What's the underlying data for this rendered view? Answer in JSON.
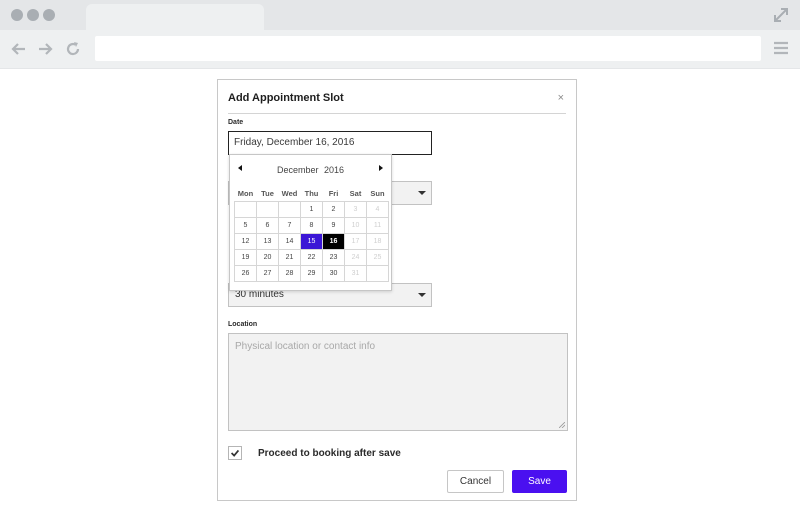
{
  "dialog": {
    "title": "Add Appointment Slot",
    "close": "×",
    "date_label": "Date",
    "date_value": "Friday, December 16, 2016",
    "duration_value": "30 minutes",
    "location_label": "Location",
    "location_placeholder": "Physical location or contact info",
    "checkbox_label": "Proceed to booking after save",
    "checkbox_checked": true,
    "cancel": "Cancel",
    "save": "Save"
  },
  "calendar": {
    "month": "December",
    "year": "2016",
    "weekdays": [
      "Mon",
      "Tue",
      "Wed",
      "Thu",
      "Fri",
      "Sat",
      "Sun"
    ],
    "weeks": [
      [
        "",
        "",
        "",
        "1",
        "2",
        "3",
        "4"
      ],
      [
        "5",
        "6",
        "7",
        "8",
        "9",
        "10",
        "11"
      ],
      [
        "12",
        "13",
        "14",
        "15",
        "16",
        "17",
        "18"
      ],
      [
        "19",
        "20",
        "21",
        "22",
        "23",
        "24",
        "25"
      ],
      [
        "26",
        "27",
        "28",
        "29",
        "30",
        "31",
        ""
      ]
    ],
    "disabled_days": [
      "3",
      "4",
      "10",
      "11",
      "17",
      "18",
      "24",
      "25",
      "31"
    ],
    "today": "15",
    "selected": "16"
  },
  "colors": {
    "accent": "#4a10f0",
    "today_bg": "#3b16d6",
    "selected_bg": "#000000"
  }
}
